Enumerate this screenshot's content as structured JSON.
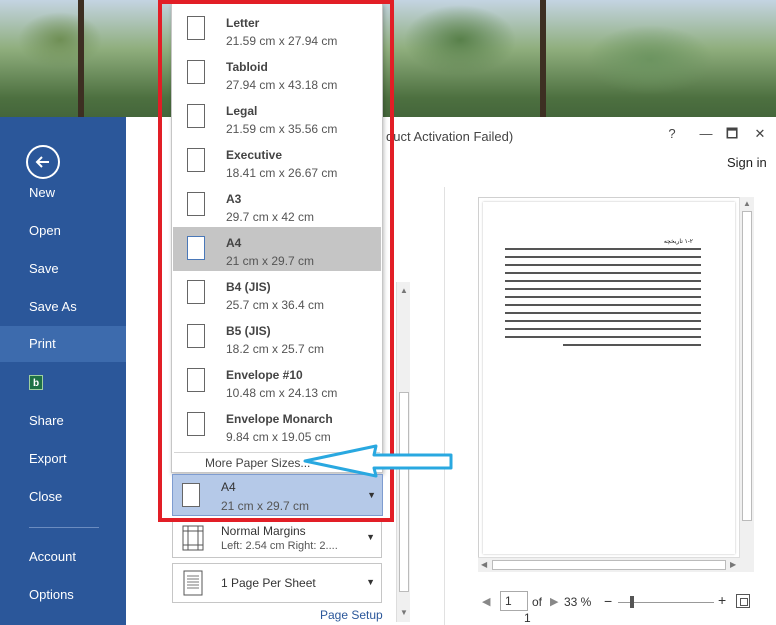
{
  "window": {
    "title": "duct Activation Failed)",
    "help": "?",
    "restore": "🗖",
    "minimize": "—",
    "close": "✕",
    "sign_in": "Sign in"
  },
  "sidebar": {
    "items": [
      {
        "label": "New"
      },
      {
        "label": "Open"
      },
      {
        "label": "Save"
      },
      {
        "label": "Save As"
      },
      {
        "label": "Print",
        "active": true
      },
      {
        "label": ""
      },
      {
        "label": "Share"
      },
      {
        "label": "Export"
      },
      {
        "label": "Close"
      },
      {
        "label": "Account"
      },
      {
        "label": "Options"
      }
    ],
    "addin_letter": "b"
  },
  "paper_sizes": [
    {
      "name": "Letter",
      "size": "21.59 cm x 27.94 cm"
    },
    {
      "name": "Tabloid",
      "size": "27.94 cm x 43.18 cm"
    },
    {
      "name": "Legal",
      "size": "21.59 cm x 35.56 cm"
    },
    {
      "name": "Executive",
      "size": "18.41 cm x 26.67 cm"
    },
    {
      "name": "A3",
      "size": "29.7 cm x 42 cm"
    },
    {
      "name": "A4",
      "size": "21 cm x 29.7 cm",
      "selected": true
    },
    {
      "name": "B4 (JIS)",
      "size": "25.7 cm x 36.4 cm"
    },
    {
      "name": "B5 (JIS)",
      "size": "18.2 cm x 25.7 cm"
    },
    {
      "name": "Envelope #10",
      "size": "10.48 cm x 24.13 cm"
    },
    {
      "name": "Envelope Monarch",
      "size": "9.84 cm x 19.05 cm"
    }
  ],
  "more_sizes": "More Paper Sizes...",
  "paper_combo": {
    "name": "A4",
    "size": "21 cm x 29.7 cm"
  },
  "margins": {
    "line1": "Normal Margins",
    "line2": "Left:  2.54 cm    Right:  2...."
  },
  "pages_per_sheet": {
    "line1": "1 Page Per Sheet"
  },
  "page_setup": "Page Setup",
  "preview": {
    "heading": "۱-۲ تاریخچه",
    "page_current": "1",
    "of_label": "of",
    "page_total": "1",
    "zoom": "33 %"
  },
  "colors": {
    "sidebar": "#2b579a",
    "highlight": "#e21e26",
    "arrow": "#29a8e0",
    "selected_combo": "#b5c9e8"
  }
}
